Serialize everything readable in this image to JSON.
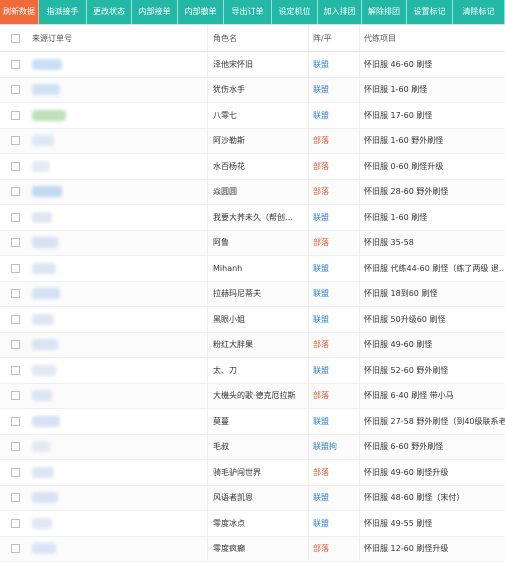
{
  "toolbar": {
    "buttons": [
      {
        "label": "刷新数据",
        "active": true
      },
      {
        "label": "指派接手",
        "active": false
      },
      {
        "label": "更改状态",
        "active": false
      },
      {
        "label": "内部接单",
        "active": false
      },
      {
        "label": "内部撤单",
        "active": false
      },
      {
        "label": "导出订单",
        "active": false
      },
      {
        "label": "设定机位",
        "active": false
      },
      {
        "label": "加入排团",
        "active": false
      },
      {
        "label": "解除排团",
        "active": false
      },
      {
        "label": "设置标记",
        "active": false
      },
      {
        "label": "清除标记",
        "active": false
      }
    ]
  },
  "table": {
    "headers": {
      "source": "来源订单号",
      "name": "角色名",
      "camp": "阵/平",
      "project": "代练项目"
    },
    "rows": [
      {
        "name": "泽他宋怀旧",
        "camp": "联盟",
        "project": "怀旧服 46-60 刷怪"
      },
      {
        "name": "犹伤水手",
        "camp": "联盟",
        "project": "怀旧服 1-60 刷怪"
      },
      {
        "name": "八零七",
        "camp": "联盟",
        "project": "怀旧服 17-60 刷怪"
      },
      {
        "name": "阿沙勒斯",
        "camp": "部落",
        "project": "怀旧服 1-60 野外刷怪"
      },
      {
        "name": "水百杨花",
        "camp": "部落",
        "project": "怀旧服 0-60 刷怪升级"
      },
      {
        "name": "焱圆圆",
        "camp": "部落",
        "project": "怀旧服 28-60 野外刷怪"
      },
      {
        "name": "我要大荞未久（帮创…",
        "camp": "联盟",
        "project": "怀旧服 1-60 刷怪"
      },
      {
        "name": "阿鲁",
        "camp": "部落",
        "project": "怀旧服 35-58"
      },
      {
        "name": "Mihanh",
        "camp": "联盟",
        "project": "怀旧服 代练44-60 刷怪（练了两级 退…"
      },
      {
        "name": "拉赫玛尼蒂夫",
        "camp": "联盟",
        "project": "怀旧服 18到60 刷怪"
      },
      {
        "name": "黑眼小姐",
        "camp": "联盟",
        "project": "怀旧服 50升级60 刷怪"
      },
      {
        "name": "粉红大胖果",
        "camp": "部落",
        "project": "怀旧服 49-60 刷怪"
      },
      {
        "name": "太、刀",
        "camp": "联盟",
        "project": "怀旧服 52-60 野外刷怪"
      },
      {
        "name": "大機头的歌·德克厄拉斯",
        "camp": "部落",
        "project": "怀旧服 6-40 刷怪 带小马"
      },
      {
        "name": "莫蔓",
        "camp": "联盟",
        "project": "怀旧服 27-58 野外刷怪（到40级联系老…"
      },
      {
        "name": "毛叔",
        "camp": "联盟拘",
        "project": "怀旧服 6-60 野外刷怪"
      },
      {
        "name": "骑毛驴闯世界",
        "camp": "部落",
        "project": "怀旧服 49-60 刷怪升级"
      },
      {
        "name": "风语者凯恩",
        "camp": "联盟",
        "project": "怀旧服 48-60 刷怪（末付）"
      },
      {
        "name": "零度冰点",
        "camp": "联盟",
        "project": "怀旧服 49-55 刷怪"
      },
      {
        "name": "零度疯癫",
        "camp": "部落",
        "project": "怀旧服 12-60 刷怪升级"
      }
    ]
  },
  "colors": {
    "active_button": "#f06a3a",
    "button": "#23b7a5",
    "alliance": "#2a7fd4",
    "horde": "#e0603a"
  }
}
